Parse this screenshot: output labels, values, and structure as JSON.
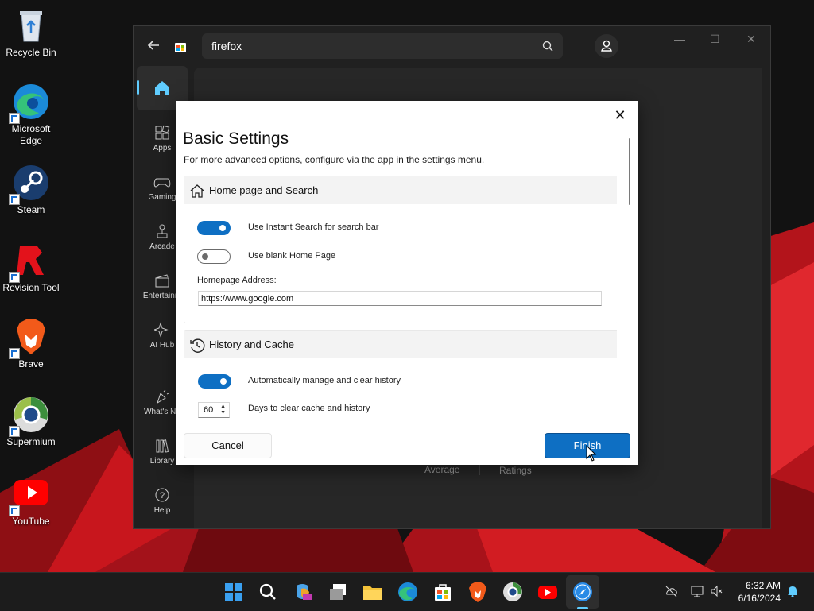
{
  "desktop": {
    "icons": [
      {
        "label": "Recycle Bin",
        "icon": "recycle-bin-icon"
      },
      {
        "label": "Microsoft Edge",
        "icon": "edge-icon"
      },
      {
        "label": "Steam",
        "icon": "steam-icon"
      },
      {
        "label": "Revision Tool",
        "icon": "revision-tool-icon"
      },
      {
        "label": "Brave",
        "icon": "brave-icon"
      },
      {
        "label": "Supermium",
        "icon": "supermium-icon"
      },
      {
        "label": "YouTube",
        "icon": "youtube-icon"
      }
    ]
  },
  "store": {
    "search_value": "firefox",
    "sidebar": [
      {
        "label": "",
        "icon": "home-icon"
      },
      {
        "label": "Apps",
        "icon": "apps-icon"
      },
      {
        "label": "Gaming",
        "icon": "gaming-icon"
      },
      {
        "label": "Arcade",
        "icon": "arcade-icon"
      },
      {
        "label": "Entertainm",
        "icon": "entertainment-icon"
      },
      {
        "label": "AI Hub",
        "icon": "ai-hub-icon"
      },
      {
        "label": "What's Ne",
        "icon": "whats-new-icon"
      },
      {
        "label": "Library",
        "icon": "library-icon"
      },
      {
        "label": "Help",
        "icon": "help-icon"
      }
    ],
    "background_labels": {
      "average": "Average",
      "ratings": "Ratings"
    }
  },
  "dialog": {
    "close_label": "✕",
    "title": "Basic Settings",
    "subtitle": "For more advanced options, configure via the app in the settings menu.",
    "sections": [
      {
        "title": "Home page and Search",
        "icon": "home-outline-icon",
        "toggles": [
          {
            "label": "Use Instant Search for search bar",
            "on": true
          },
          {
            "label": "Use blank Home Page",
            "on": false
          }
        ],
        "field_label": "Homepage Address:",
        "field_value": "https://www.google.com"
      },
      {
        "title": "History and Cache",
        "icon": "history-icon",
        "toggles": [
          {
            "label": "Automatically manage and clear history",
            "on": true
          }
        ],
        "stepper_value": "60",
        "stepper_label": "Days to clear cache and history"
      }
    ],
    "cancel_label": "Cancel",
    "finish_label": "Finish"
  },
  "taskbar": {
    "time": "6:32 AM",
    "date": "6/16/2024"
  },
  "colors": {
    "accent": "#0e6fc3",
    "wallpaper_red": "#c8161d"
  }
}
